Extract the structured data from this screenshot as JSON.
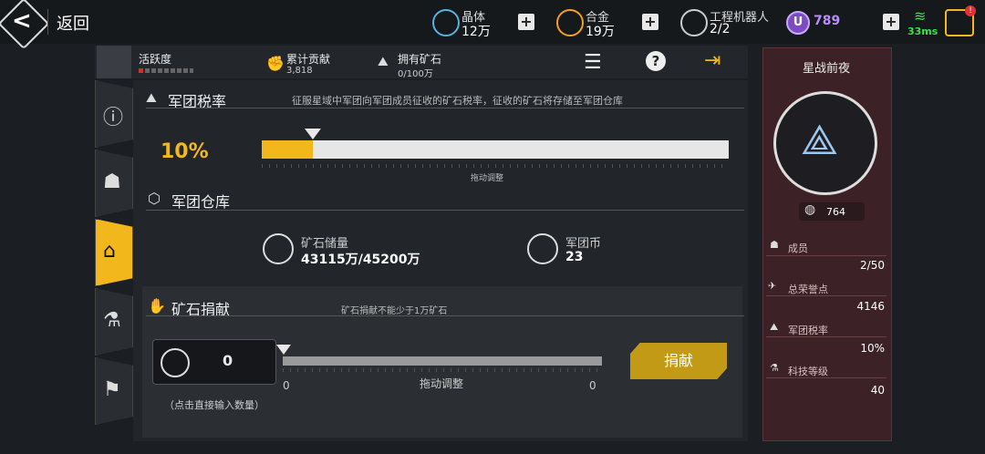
{
  "topbar": {
    "back_label": "返回",
    "crystal": {
      "title": "晶体",
      "value": "12万"
    },
    "alloy": {
      "title": "合金",
      "value": "19万"
    },
    "robot": {
      "title": "工程机器人",
      "value": "2/2"
    },
    "u_value": "789",
    "u_symbol": "U",
    "ping": "33ms",
    "plus": "+",
    "cart_badge": "!"
  },
  "header": {
    "activity_label": "活跃度",
    "contribution_label": "累计贡献",
    "contribution_value": "3,818",
    "ore_label": "拥有矿石",
    "ore_value": "0/100万",
    "help_icon": "?"
  },
  "tax": {
    "title": "军团税率",
    "description": "征服星域中军团向军团成员征收的矿石税率，征收的矿石将存储至军团仓库",
    "value": "10%",
    "fill_fraction": 0.11,
    "hint": "拖动调整"
  },
  "warehouse": {
    "title": "军团仓库",
    "ore_label": "矿石储量",
    "ore_value": "43115万/45200万",
    "coin_label": "军团币",
    "coin_value": "23"
  },
  "donate": {
    "title": "矿石捐献",
    "note": "矿石捐献不能少于1万矿石",
    "input_value": "0",
    "input_hint": "（点击直接输入数量）",
    "slider_min": "0",
    "slider_max": "0",
    "slider_hint": "拖动调整",
    "button_label": "捐献"
  },
  "legion": {
    "name": "星战前夜",
    "score": "764",
    "members_label": "成员",
    "members_value": "2/50",
    "honor_label": "总荣誉点",
    "honor_value": "4146",
    "tax_label": "军团税率",
    "tax_value": "10%",
    "tech_label": "科技等级",
    "tech_value": "40"
  },
  "colors": {
    "accent": "#f2b71a",
    "panel_red": "#3c2226",
    "dark": "#1b1e22"
  }
}
